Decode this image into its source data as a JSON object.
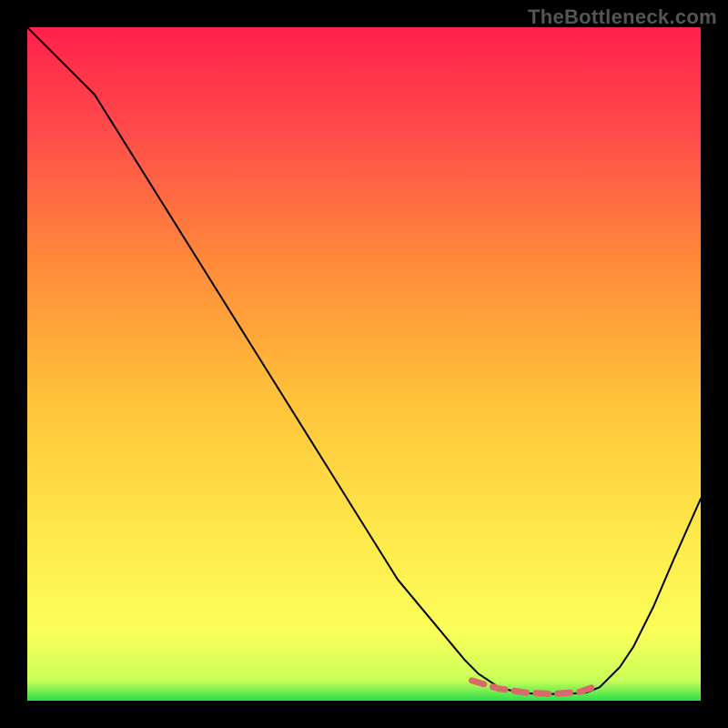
{
  "watermark": "TheBottleneck.com",
  "chart_data": {
    "type": "line",
    "title": "",
    "xlabel": "",
    "ylabel": "",
    "xlim": [
      0,
      100
    ],
    "ylim": [
      0,
      100
    ],
    "grid": false,
    "legend": false,
    "series": [
      {
        "name": "curve",
        "stroke": "#000000",
        "stroke_width": 2,
        "x": [
          0,
          5,
          10,
          15,
          20,
          25,
          30,
          35,
          40,
          45,
          50,
          55,
          60,
          65,
          67,
          70,
          73,
          76,
          80,
          83,
          85,
          88,
          90,
          93,
          96,
          100
        ],
        "y": [
          100,
          95,
          90,
          82,
          74,
          66,
          58,
          50,
          42,
          34,
          26,
          18,
          12,
          6,
          4,
          2,
          1.2,
          1.0,
          1.0,
          1.2,
          2,
          5,
          8,
          14,
          21,
          30
        ]
      },
      {
        "name": "trough-marker",
        "stroke": "#d86a6a",
        "stroke_width": 7,
        "dash": "14 10",
        "x": [
          66,
          70,
          74,
          78,
          82,
          84
        ],
        "y": [
          3.0,
          1.8,
          1.2,
          1.0,
          1.3,
          2.0
        ]
      }
    ],
    "gradient_stops": [
      {
        "offset": 0.0,
        "color": "#ff1f4b"
      },
      {
        "offset": 0.15,
        "color": "#ff4a4a"
      },
      {
        "offset": 0.35,
        "color": "#ff8a3a"
      },
      {
        "offset": 0.55,
        "color": "#ffc23a"
      },
      {
        "offset": 0.75,
        "color": "#ffe84a"
      },
      {
        "offset": 0.9,
        "color": "#faff5a"
      },
      {
        "offset": 0.97,
        "color": "#c8ff58"
      },
      {
        "offset": 1.0,
        "color": "#2bdf4a"
      }
    ]
  }
}
